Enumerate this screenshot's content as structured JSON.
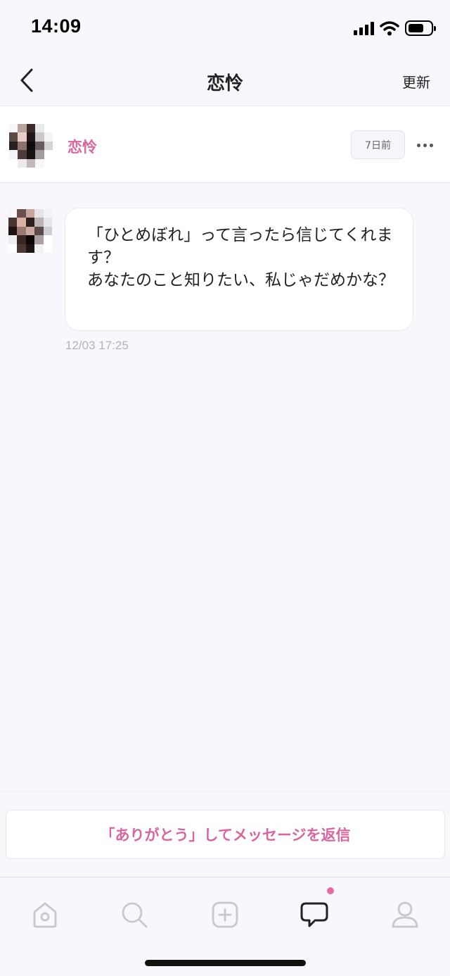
{
  "status_bar": {
    "time": "14:09",
    "battery_level": 0.65,
    "icons": [
      "signal-icon",
      "wifi-icon",
      "battery-icon"
    ]
  },
  "nav": {
    "title": "恋怜",
    "back_icon": "chevron-left-icon",
    "refresh_label": "更新"
  },
  "sender": {
    "name": "恋怜",
    "time_ago": "7日前",
    "menu_icon": "more-icon"
  },
  "message": {
    "text": "「ひとめぼれ」って言ったら信じてくれます？\nあなたのこと知りたい、私じゃだめかな？",
    "time": "12/03 17:25"
  },
  "reply": {
    "button_label": "「ありがとう」してメッセージを返信"
  },
  "tab_bar": {
    "tabs": [
      {
        "icon": "home-icon",
        "active": false
      },
      {
        "icon": "search-icon",
        "active": false
      },
      {
        "icon": "plus-icon",
        "active": false
      },
      {
        "icon": "message-icon",
        "active": true,
        "badge": true
      },
      {
        "icon": "profile-icon",
        "active": false
      }
    ]
  },
  "colors": {
    "accent": "#d9659e",
    "badge": "#e8699f",
    "background": "#f8f7fc",
    "inactive_icon": "#c8c7cf"
  }
}
